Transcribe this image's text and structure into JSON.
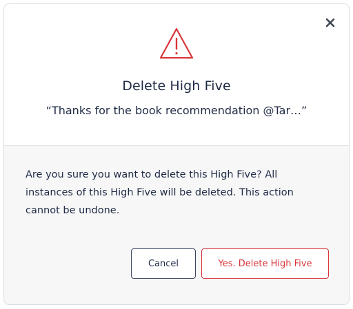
{
  "dialog": {
    "title": "Delete High Five",
    "quote": "“Thanks for the book recommendation @Tar…”",
    "message": "Are you sure you want to delete this High Five? All instances of this High Five will be deleted. This action cannot be undone.",
    "close_icon": "close-icon",
    "warning_icon": "warning-triangle-icon",
    "buttons": {
      "cancel_label": "Cancel",
      "confirm_label": "Yes. Delete High Five"
    }
  },
  "colors": {
    "danger": "#d8353b",
    "text": "#1f2a44",
    "body_background": "#f7f7f8",
    "border": "#dcdde3"
  }
}
